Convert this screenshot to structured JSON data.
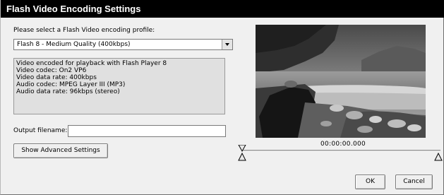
{
  "window": {
    "title": "Flash Video Encoding Settings"
  },
  "profile": {
    "label": "Please select a Flash Video encoding profile:",
    "selected": "Flash 8 - Medium Quality (400kbps)"
  },
  "info_lines": [
    "Video encoded for playback with Flash Player 8",
    "Video codec: On2 VP6",
    "Video data rate: 400kbps",
    "Audio codec: MPEG Layer III (MP3)",
    "Audio data rate: 96kbps (stereo)"
  ],
  "output": {
    "label": "Output filename:",
    "value": ""
  },
  "buttons": {
    "advanced": "Show Advanced Settings",
    "ok": "OK",
    "cancel": "Cancel"
  },
  "preview": {
    "timecode": "00:00:00.000"
  }
}
